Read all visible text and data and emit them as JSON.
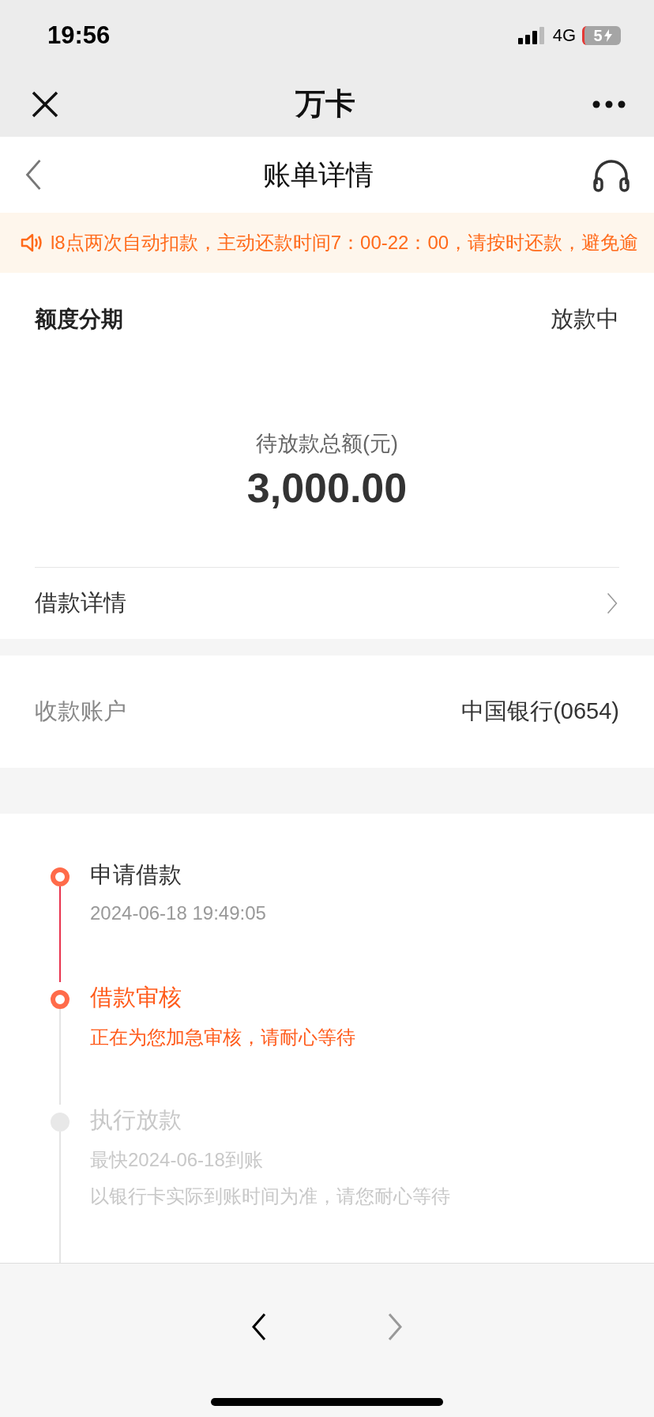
{
  "status_bar": {
    "time": "19:56",
    "network": "4G",
    "battery": "5",
    "charging": true
  },
  "nav_bar": {
    "title": "万卡"
  },
  "page_header": {
    "title": "账单详情"
  },
  "notice": {
    "text": "l8点两次自动扣款，主动还款时间7：00-22：00，请按时还款，避免逾"
  },
  "loan_card": {
    "type": "额度分期",
    "status": "放款中",
    "amount_label": "待放款总额(元)",
    "amount": "3,000.00",
    "detail_link": "借款详情"
  },
  "account": {
    "label": "收款账户",
    "value": "中国银行(0654)"
  },
  "timeline": [
    {
      "kind": "done",
      "title": "申请借款",
      "lines": [
        "2024-06-18 19:49:05"
      ]
    },
    {
      "kind": "current",
      "title": "借款审核",
      "lines": [
        "正在为您加急审核，请耐心等待"
      ]
    },
    {
      "kind": "pending",
      "title": "执行放款",
      "lines": [
        "最快2024-06-18到账",
        "以银行卡实际到账时间为准，请您耐心等待"
      ]
    }
  ],
  "browser_nav": {
    "back_disabled": false,
    "forward_disabled": true
  }
}
